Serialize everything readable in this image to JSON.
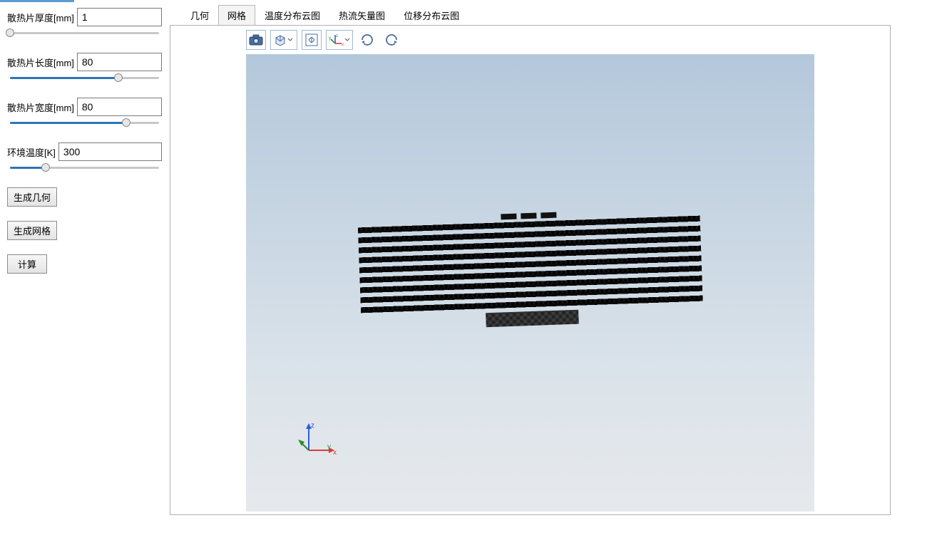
{
  "sidebar": {
    "params": [
      {
        "label": "散热片厚度[mm]",
        "value": "1",
        "fill_pct": 0
      },
      {
        "label": "散热片长度[mm]",
        "value": "80",
        "fill_pct": 72
      },
      {
        "label": "散热片宽度[mm]",
        "value": "80",
        "fill_pct": 77
      },
      {
        "label": "环境温度[K]",
        "value": "300",
        "fill_pct": 25
      }
    ],
    "buttons": {
      "gen_geom": "生成几何",
      "gen_mesh": "生成网格",
      "compute": "计算"
    }
  },
  "tabs": [
    {
      "label": "几何",
      "active": false
    },
    {
      "label": "网格",
      "active": true
    },
    {
      "label": "温度分布云图",
      "active": false
    },
    {
      "label": "热流矢量图",
      "active": false
    },
    {
      "label": "位移分布云图",
      "active": false
    }
  ],
  "toolbar_icons": [
    "camera-icon",
    "cube-view-icon",
    "fit-view-icon",
    "axes-icon",
    "rotate-cw-icon",
    "rotate-ccw-icon"
  ],
  "triad": {
    "x_label": "x",
    "y_label": "y",
    "z_label": "z",
    "x_color": "#d83b3b",
    "y_color": "#2e8b2e",
    "z_color": "#2e5bd8"
  }
}
